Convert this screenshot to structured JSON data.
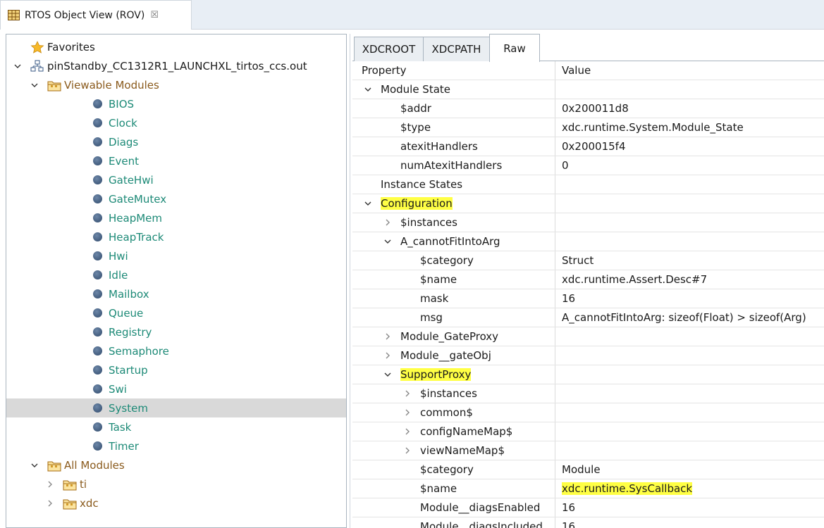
{
  "view": {
    "title": "RTOS Object View (ROV)",
    "close_glyph": "☒"
  },
  "tree": {
    "rows": [
      {
        "label": "Favorites",
        "icon": "star-icon",
        "indent": 0,
        "twisty": "none"
      },
      {
        "label": "pinStandby_CC1312R1_LAUNCHXL_tirtos_ccs.out",
        "icon": "executable-icon",
        "indent": 0,
        "twisty": "expanded"
      },
      {
        "label": "Viewable Modules",
        "icon": "package-folder-icon",
        "indent": 1,
        "twisty": "expanded"
      },
      {
        "label": "BIOS",
        "icon": "module-dot-icon",
        "indent": 2
      },
      {
        "label": "Clock",
        "icon": "module-dot-icon",
        "indent": 2
      },
      {
        "label": "Diags",
        "icon": "module-dot-icon",
        "indent": 2
      },
      {
        "label": "Event",
        "icon": "module-dot-icon",
        "indent": 2
      },
      {
        "label": "GateHwi",
        "icon": "module-dot-icon",
        "indent": 2
      },
      {
        "label": "GateMutex",
        "icon": "module-dot-icon",
        "indent": 2
      },
      {
        "label": "HeapMem",
        "icon": "module-dot-icon",
        "indent": 2
      },
      {
        "label": "HeapTrack",
        "icon": "module-dot-icon",
        "indent": 2
      },
      {
        "label": "Hwi",
        "icon": "module-dot-icon",
        "indent": 2
      },
      {
        "label": "Idle",
        "icon": "module-dot-icon",
        "indent": 2
      },
      {
        "label": "Mailbox",
        "icon": "module-dot-icon",
        "indent": 2
      },
      {
        "label": "Queue",
        "icon": "module-dot-icon",
        "indent": 2
      },
      {
        "label": "Registry",
        "icon": "module-dot-icon",
        "indent": 2
      },
      {
        "label": "Semaphore",
        "icon": "module-dot-icon",
        "indent": 2
      },
      {
        "label": "Startup",
        "icon": "module-dot-icon",
        "indent": 2
      },
      {
        "label": "Swi",
        "icon": "module-dot-icon",
        "indent": 2
      },
      {
        "label": "System",
        "icon": "module-dot-icon",
        "indent": 2,
        "selected": true
      },
      {
        "label": "Task",
        "icon": "module-dot-icon",
        "indent": 2
      },
      {
        "label": "Timer",
        "icon": "module-dot-icon",
        "indent": 2
      },
      {
        "label": "All Modules",
        "icon": "package-folder-icon",
        "indent": 1,
        "twisty": "expanded"
      },
      {
        "label": "ti",
        "icon": "package-folder-icon",
        "indent": 2,
        "twisty": "collapsed"
      },
      {
        "label": "xdc",
        "icon": "package-folder-icon",
        "indent": 2,
        "twisty": "collapsed"
      }
    ]
  },
  "tabs": [
    {
      "label": "XDCROOT",
      "active": false
    },
    {
      "label": "XDCPATH",
      "active": false
    },
    {
      "label": "Raw",
      "active": true
    }
  ],
  "table": {
    "headers": {
      "property": "Property",
      "value": "Value"
    },
    "rows": [
      {
        "property": "Module State",
        "value": "",
        "level": 0,
        "twisty": "expanded"
      },
      {
        "property": "$addr",
        "value": "0x200011d8",
        "level": 1
      },
      {
        "property": "$type",
        "value": "xdc.runtime.System.Module_State",
        "level": 1
      },
      {
        "property": "atexitHandlers",
        "value": "0x200015f4",
        "level": 1
      },
      {
        "property": "numAtexitHandlers",
        "value": "0",
        "level": 1
      },
      {
        "property": "Instance States",
        "value": "",
        "level": 0,
        "twisty": "none"
      },
      {
        "property": "Configuration",
        "value": "",
        "level": 0,
        "twisty": "expanded",
        "highlight_prop": true
      },
      {
        "property": "$instances",
        "value": "",
        "level": 1,
        "twisty": "collapsed"
      },
      {
        "property": "A_cannotFitIntoArg",
        "value": "",
        "level": 1,
        "twisty": "expanded"
      },
      {
        "property": "$category",
        "value": "Struct",
        "level": 2
      },
      {
        "property": "$name",
        "value": "xdc.runtime.Assert.Desc#7",
        "level": 2
      },
      {
        "property": "mask",
        "value": "16",
        "level": 2
      },
      {
        "property": "msg",
        "value": "A_cannotFitIntoArg: sizeof(Float) > sizeof(Arg)",
        "level": 2
      },
      {
        "property": "Module_GateProxy",
        "value": "",
        "level": 1,
        "twisty": "collapsed"
      },
      {
        "property": "Module__gateObj",
        "value": "",
        "level": 1,
        "twisty": "collapsed"
      },
      {
        "property": "SupportProxy",
        "value": "",
        "level": 1,
        "twisty": "expanded",
        "highlight_prop": true
      },
      {
        "property": "$instances",
        "value": "",
        "level": 2,
        "twisty": "collapsed"
      },
      {
        "property": "common$",
        "value": "",
        "level": 2,
        "twisty": "collapsed"
      },
      {
        "property": "configNameMap$",
        "value": "",
        "level": 2,
        "twisty": "collapsed"
      },
      {
        "property": "viewNameMap$",
        "value": "",
        "level": 2,
        "twisty": "collapsed"
      },
      {
        "property": "$category",
        "value": "Module",
        "level": 2
      },
      {
        "property": "$name",
        "value": "xdc.runtime.SysCallback",
        "level": 2,
        "highlight_val": true
      },
      {
        "property": "Module__diagsEnabled",
        "value": "16",
        "level": 2
      },
      {
        "property": "Module__diagsIncluded",
        "value": "16",
        "level": 2
      }
    ]
  },
  "colors": {
    "highlight": "#ffff44",
    "folder_text": "#8a5a1c",
    "module_text": "#1d8a77",
    "selection": "#d9d9d9"
  }
}
